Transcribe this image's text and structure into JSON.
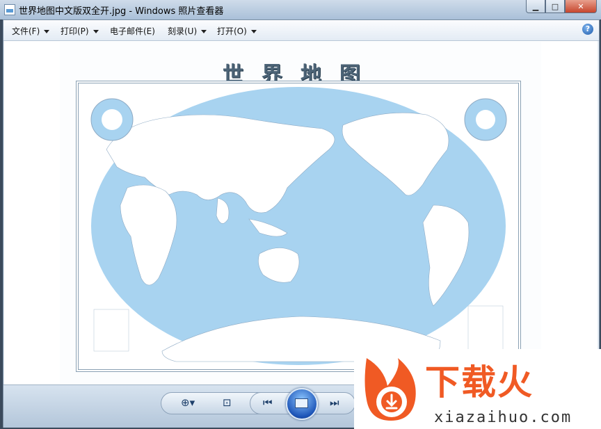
{
  "window": {
    "title": "世界地图中文版双全开.jpg - Windows 照片查看器",
    "controls": {
      "minimize": "▁",
      "maximize": "□",
      "close": "✕"
    }
  },
  "menubar": {
    "items": [
      {
        "label": "文件(F)"
      },
      {
        "label": "打印(P)"
      },
      {
        "label": "电子邮件(E)"
      },
      {
        "label": "刻录(U)"
      },
      {
        "label": "打开(O)"
      }
    ],
    "help": "?"
  },
  "image": {
    "map_title": "世界地图",
    "ocean_color": "#a8d3f0",
    "land_color": "#ffffff",
    "antarctica_color": "#ffffff"
  },
  "toolbar": {
    "zoom_icon": "zoom-icon",
    "fit_icon": "fit-window-icon",
    "prev_icon": "previous-icon",
    "slideshow_icon": "slideshow-icon",
    "next_icon": "next-icon"
  },
  "watermark": {
    "brand": "下载火",
    "domain": "xiazaihuo.com",
    "accent": "#f05a24"
  }
}
